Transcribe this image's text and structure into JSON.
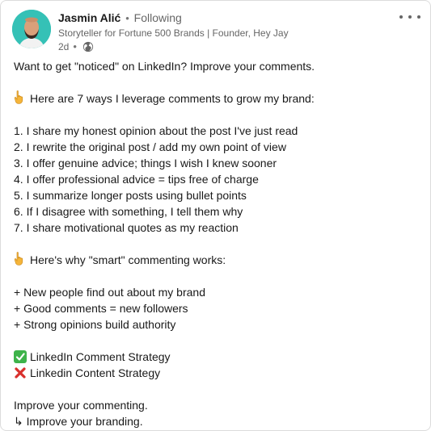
{
  "author": {
    "name": "Jasmin Alić",
    "follow_status": "Following",
    "tagline": "Storyteller for Fortune 500 Brands | Founder, Hey Jay",
    "time_ago": "2d"
  },
  "icons": {
    "more": "more-horizontal-icon",
    "visibility": "globe-icon",
    "pointer": "pointing-down-emoji",
    "check": "check-mark-emoji",
    "cross": "cross-mark-emoji"
  },
  "colors": {
    "avatar_bg": "#35c1b6",
    "check_green": "#3eb34a",
    "cross_red": "#d9302c"
  },
  "post": {
    "intro": "Want to get \"noticed\" on LinkedIn? Improve your comments.",
    "ways_heading": "Here are 7 ways I leverage comments to grow my brand:",
    "ways": [
      "1. I share my honest opinion about the post I've just read",
      "2. I rewrite the original post / add my own point of view",
      "3. I offer genuine advice; things I wish I knew sooner",
      "4. I offer professional advice = tips free of charge",
      "5. I summarize longer posts using bullet points",
      "6. If I disagree with something, I tell them why",
      "7. I share motivational quotes as my reaction"
    ],
    "why_heading": "Here's why \"smart\" commenting works:",
    "benefits": [
      "+ New people find out about my brand",
      "+ Good comments = new followers",
      "+ Strong opinions build authority"
    ],
    "yes_strategy": "LinkedIn Comment Strategy",
    "no_strategy": "Linkedin Content Strategy",
    "closing_1": "Improve your commenting.",
    "closing_2": "↳ Improve your branding."
  }
}
